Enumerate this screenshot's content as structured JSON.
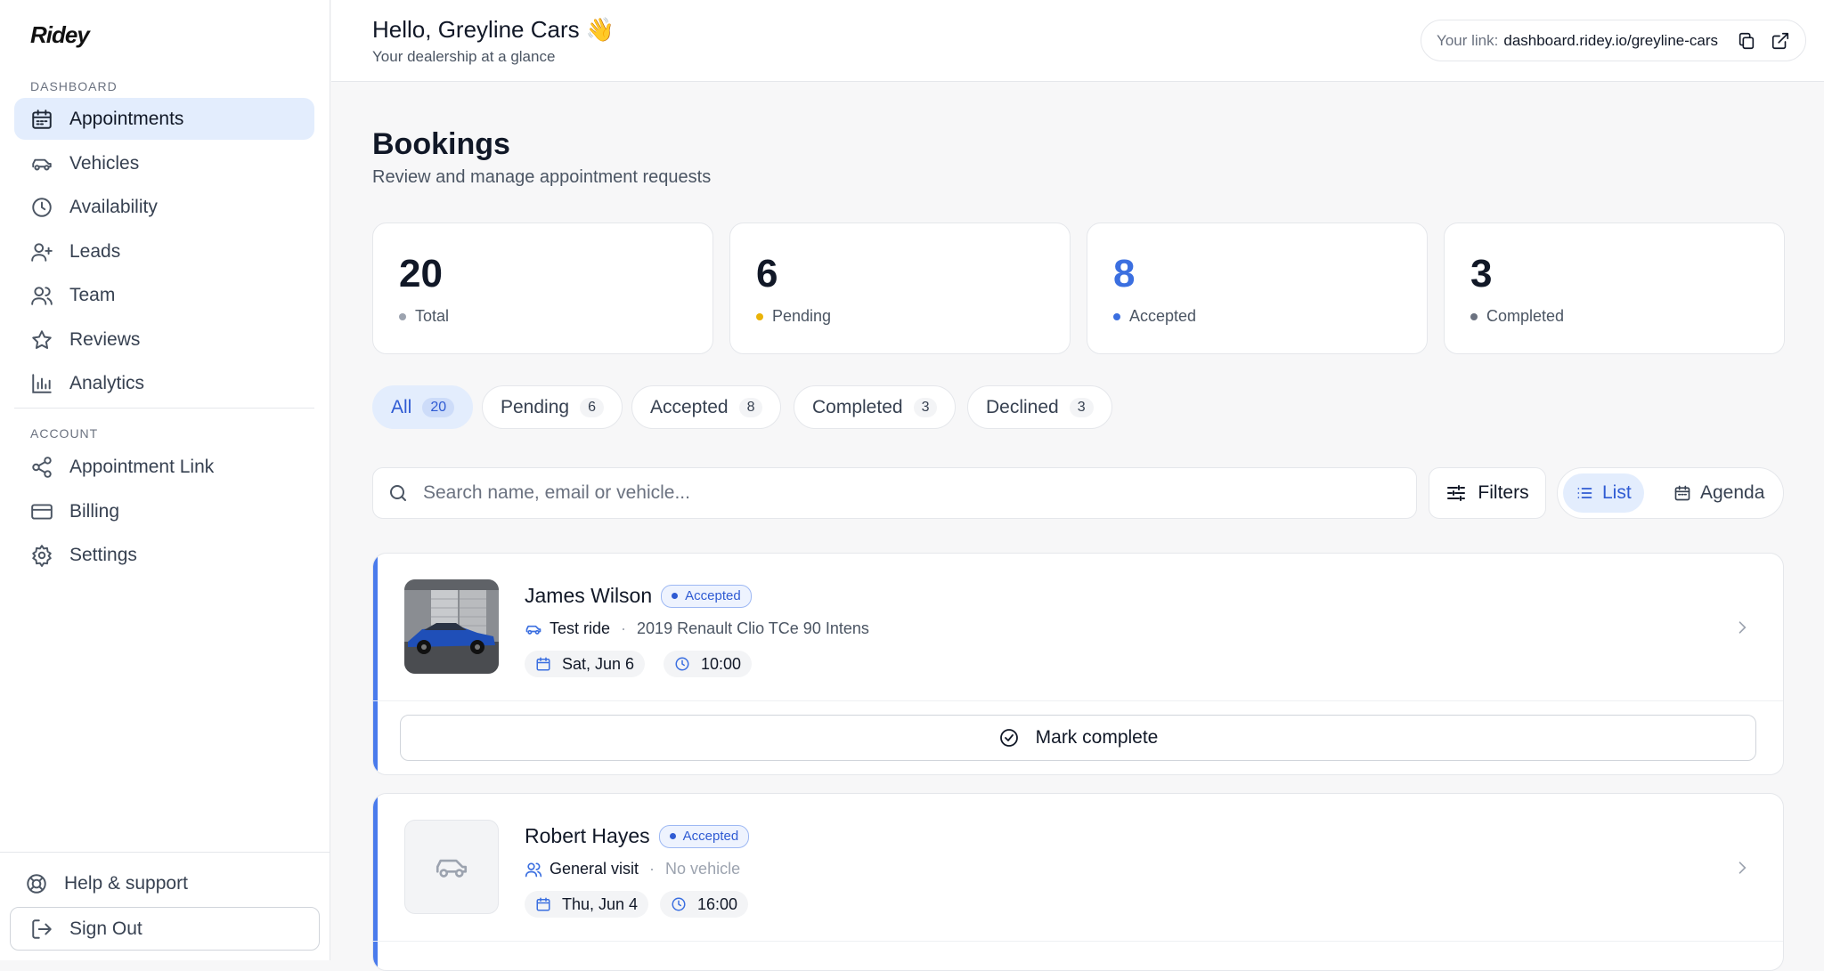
{
  "app": {
    "logo": "Ridey"
  },
  "sidebar": {
    "section_dashboard": "DASHBOARD",
    "section_account": "ACCOUNT",
    "items": [
      {
        "label": "Appointments",
        "icon": "calendar-icon"
      },
      {
        "label": "Vehicles",
        "icon": "car-icon"
      },
      {
        "label": "Availability",
        "icon": "clock-icon"
      },
      {
        "label": "Leads",
        "icon": "user-plus-icon"
      },
      {
        "label": "Team",
        "icon": "users-icon"
      },
      {
        "label": "Reviews",
        "icon": "star-icon"
      },
      {
        "label": "Analytics",
        "icon": "bar-chart-icon"
      }
    ],
    "account_items": [
      {
        "label": "Appointment Link",
        "icon": "share-icon"
      },
      {
        "label": "Billing",
        "icon": "credit-card-icon"
      },
      {
        "label": "Settings",
        "icon": "gear-icon"
      }
    ],
    "help_label": "Help & support",
    "signout_label": "Sign Out"
  },
  "header": {
    "greeting": "Hello, Greyline Cars 👋",
    "subtitle": "Your dealership at a glance",
    "link_label": "Your link:",
    "link_url": "dashboard.ridey.io/greyline-cars"
  },
  "page": {
    "title": "Bookings",
    "description": "Review and manage appointment requests"
  },
  "stats": [
    {
      "value": "20",
      "label": "Total",
      "dot_color": "#9ca3af"
    },
    {
      "value": "6",
      "label": "Pending",
      "dot_color": "#eab308"
    },
    {
      "value": "8",
      "label": "Accepted",
      "dot_color": "#3b6fe0"
    },
    {
      "value": "3",
      "label": "Completed",
      "dot_color": "#6b7280"
    }
  ],
  "tabs": [
    {
      "label": "All",
      "count": "20"
    },
    {
      "label": "Pending",
      "count": "6"
    },
    {
      "label": "Accepted",
      "count": "8"
    },
    {
      "label": "Completed",
      "count": "3"
    },
    {
      "label": "Declined",
      "count": "3"
    }
  ],
  "search": {
    "placeholder": "Search name, email or vehicle..."
  },
  "toolbar": {
    "filters_label": "Filters",
    "list_label": "List",
    "agenda_label": "Agenda"
  },
  "bookings": [
    {
      "name": "James Wilson",
      "status": "Accepted",
      "type": "Test ride",
      "vehicle": "2019 Renault Clio TCe 90 Intens",
      "date": "Sat, Jun 6",
      "time": "10:00",
      "action": "Mark complete"
    },
    {
      "name": "Robert Hayes",
      "status": "Accepted",
      "type": "General visit",
      "vehicle": "No vehicle",
      "date": "Thu, Jun 4",
      "time": "16:00"
    }
  ],
  "colors": {
    "accent": "#3b6fe0",
    "active_bg": "#e3edfd"
  }
}
